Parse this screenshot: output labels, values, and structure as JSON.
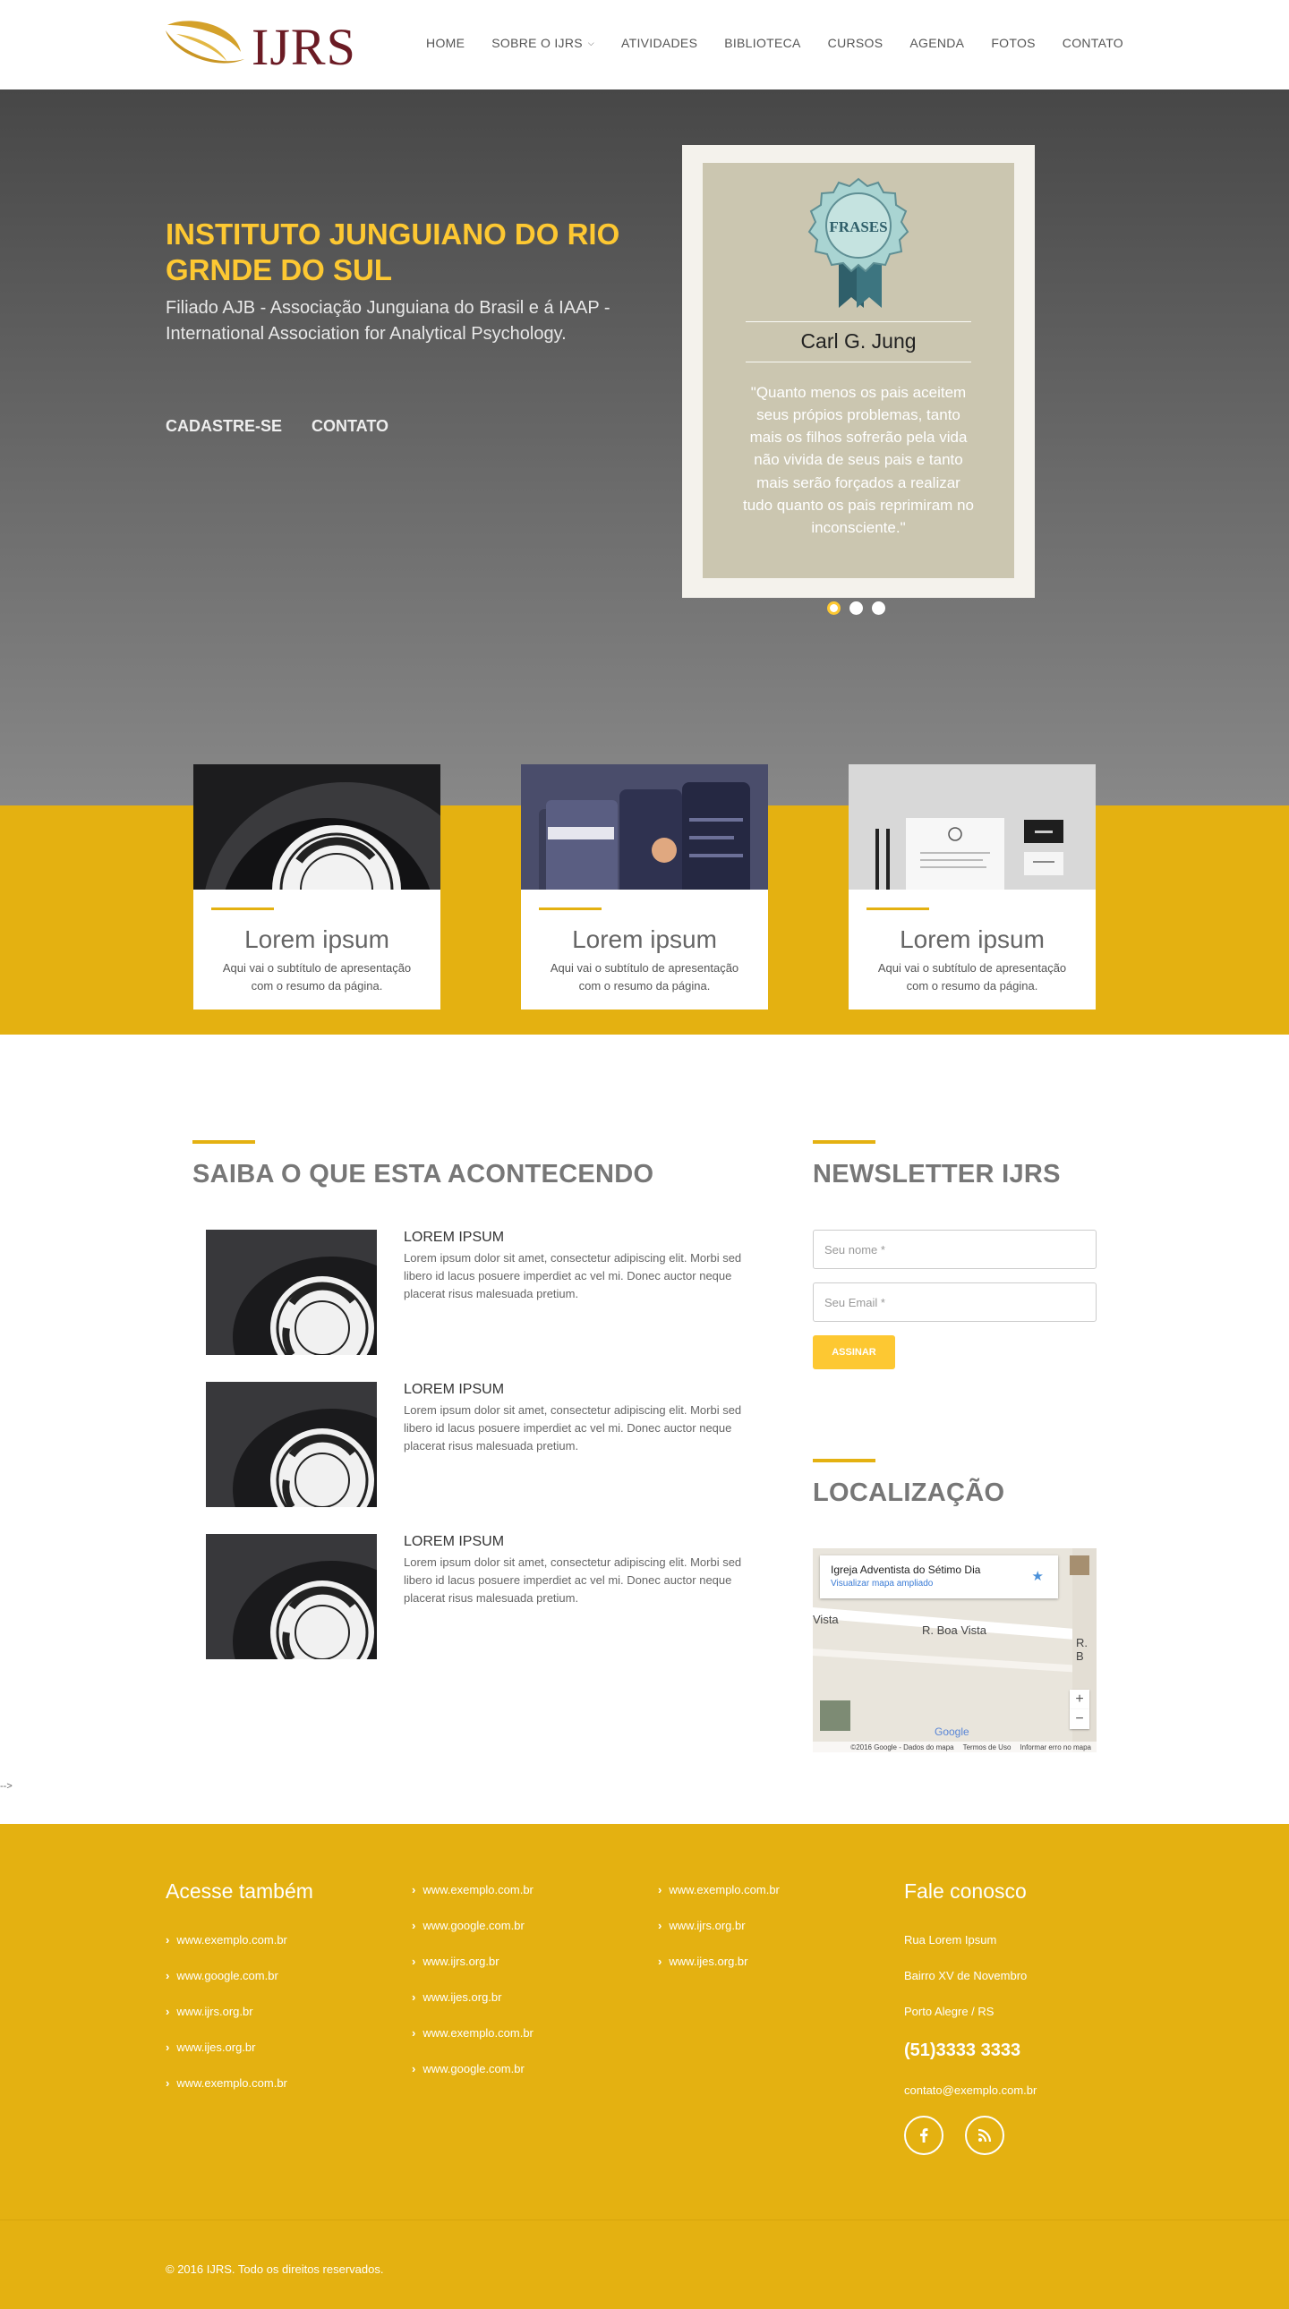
{
  "header": {
    "logo_text": "IJRS",
    "nav": [
      {
        "label": "HOME"
      },
      {
        "label": "SOBRE O IJRS",
        "has_dropdown": true
      },
      {
        "label": "ATIVIDADES"
      },
      {
        "label": "BIBLIOTECA"
      },
      {
        "label": "CURSOS"
      },
      {
        "label": "AGENDA"
      },
      {
        "label": "FOTOS"
      },
      {
        "label": "CONTATO"
      }
    ]
  },
  "hero": {
    "title": "INSTITUTO JUNGUIANO DO RIO GRNDE DO SUL",
    "subtitle": "Filiado AJB - Associação Junguiana do Brasil e á IAAP - International Association for Analytical Psychology.",
    "links": [
      "CADASTRE-SE",
      "CONTATO"
    ],
    "quote": {
      "badge_label": "FRASES",
      "author": "Carl G. Jung",
      "text": "\"Quanto menos os pais aceitem seus própios problemas, tanto mais os filhos sofrerão pela vida não vivida de seus pais e tanto mais serão forçados a realizar tudo quanto os pais reprimiram no inconsciente.\""
    },
    "slider_active": 1,
    "slider_count": 3
  },
  "features": [
    {
      "title": "Lorem ipsum",
      "text": "Aqui vai o subtítulo de apresentação com o resumo da página.",
      "image": "malt-tonic-bottle"
    },
    {
      "title": "Lorem ipsum",
      "text": "Aqui vai o subtítulo de apresentação com o resumo da página.",
      "image": "mobile-app-screens"
    },
    {
      "title": "Lorem ipsum",
      "text": "Aqui vai o subtítulo de apresentação com o resumo da página.",
      "image": "stationery-mockup"
    }
  ],
  "news_section": {
    "title": "SAIBA O QUE ESTA ACONTECENDO",
    "items": [
      {
        "title": "LOREM IPSUM",
        "text": "Lorem ipsum dolor sit amet, consectetur adipiscing elit. Morbi sed libero id lacus posuere imperdiet ac vel mi. Donec auctor neque placerat risus malesuada pretium."
      },
      {
        "title": "LOREM IPSUM",
        "text": "Lorem ipsum dolor sit amet, consectetur adipiscing elit. Morbi sed libero id lacus posuere imperdiet ac vel mi. Donec auctor neque placerat risus malesuada pretium."
      },
      {
        "title": "LOREM IPSUM",
        "text": "Lorem ipsum dolor sit amet, consectetur adipiscing elit. Morbi sed libero id lacus posuere imperdiet ac vel mi. Donec auctor neque placerat risus malesuada pretium."
      }
    ]
  },
  "newsletter": {
    "title": "NEWSLETTER IJRS",
    "name_placeholder": "Seu nome *",
    "email_placeholder": "Seu Email *",
    "button_label": "ASSINAR"
  },
  "location": {
    "title": "LOCALIZAÇÃO",
    "place_name": "Igreja Adventista do Sétimo Dia",
    "map_link": "Visualizar mapa ampliado",
    "roads": [
      "Vista",
      "R. Boa Vista",
      "R. B"
    ],
    "google_label": "Google",
    "zoom_in": "+",
    "zoom_out": "−",
    "footer_items": [
      "©2016 Google - Dados do mapa",
      "Termos de Uso",
      "Informar erro no mapa"
    ]
  },
  "stray_text": "-->",
  "footer": {
    "col1_title": "Acesse também",
    "col1_links": [
      "www.exemplo.com.br",
      "www.google.com.br",
      "www.ijrs.org.br",
      "www.ijes.org.br",
      "www.exemplo.com.br"
    ],
    "col2_links": [
      "www.exemplo.com.br",
      "www.google.com.br",
      "www.ijrs.org.br",
      "www.ijes.org.br",
      "www.exemplo.com.br",
      "www.google.com.br"
    ],
    "col3_links": [
      "www.exemplo.com.br",
      "www.ijrs.org.br",
      "www.ijes.org.br"
    ],
    "contact_title": "Fale conosco",
    "address": [
      "Rua Lorem Ipsum",
      "Bairro XV de Novembro",
      "Porto Alegre / RS"
    ],
    "phone": "(51)3333 3333",
    "email": "contato@exemplo.com.br",
    "social": [
      "facebook-icon",
      "rss-icon"
    ],
    "copyright": "© 2016 IJRS. Todo os direitos reservados."
  },
  "colors": {
    "accent": "#e4b111",
    "highlight": "#fdc832",
    "brand": "#6b1b24",
    "quote_bg": "#cbc6b0"
  }
}
